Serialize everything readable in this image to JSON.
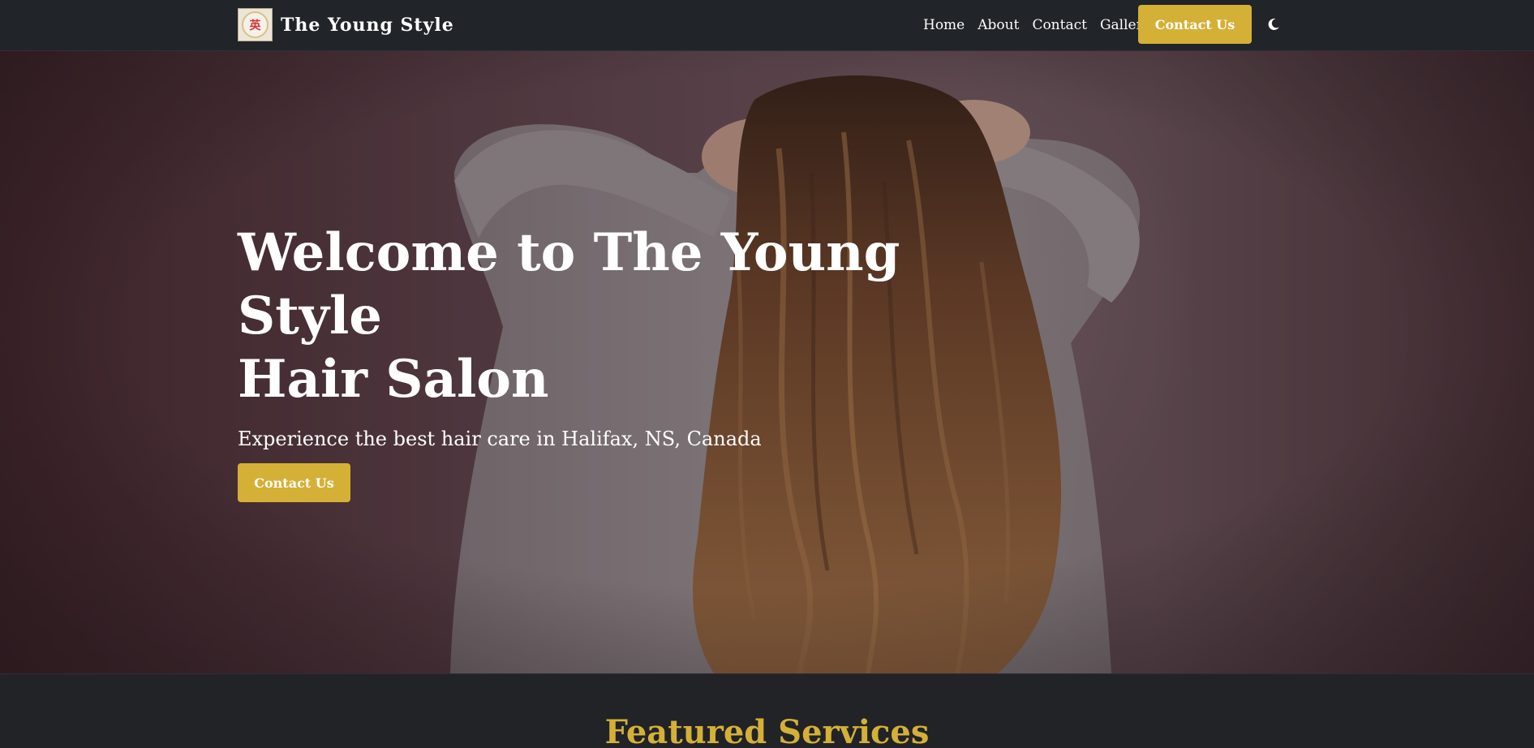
{
  "brand": {
    "name": "The Young Style",
    "logo_glyph": "英",
    "logo_icon": "salon-logo-icon"
  },
  "nav": {
    "links": [
      "Home",
      "About",
      "Contact",
      "Gallery"
    ],
    "cta_label": "Contact Us",
    "theme_icon": "moon-icon"
  },
  "hero": {
    "title_line1": "Welcome to The Young Style",
    "title_line2": "Hair Salon",
    "subtitle": "Experience the best hair care in Halifax, NS, Canada",
    "cta_label": "Contact Us"
  },
  "featured": {
    "title": "Featured Services"
  },
  "colors": {
    "accent": "#d4b037",
    "nav_bg": "#212428",
    "page_bg": "#212327"
  }
}
